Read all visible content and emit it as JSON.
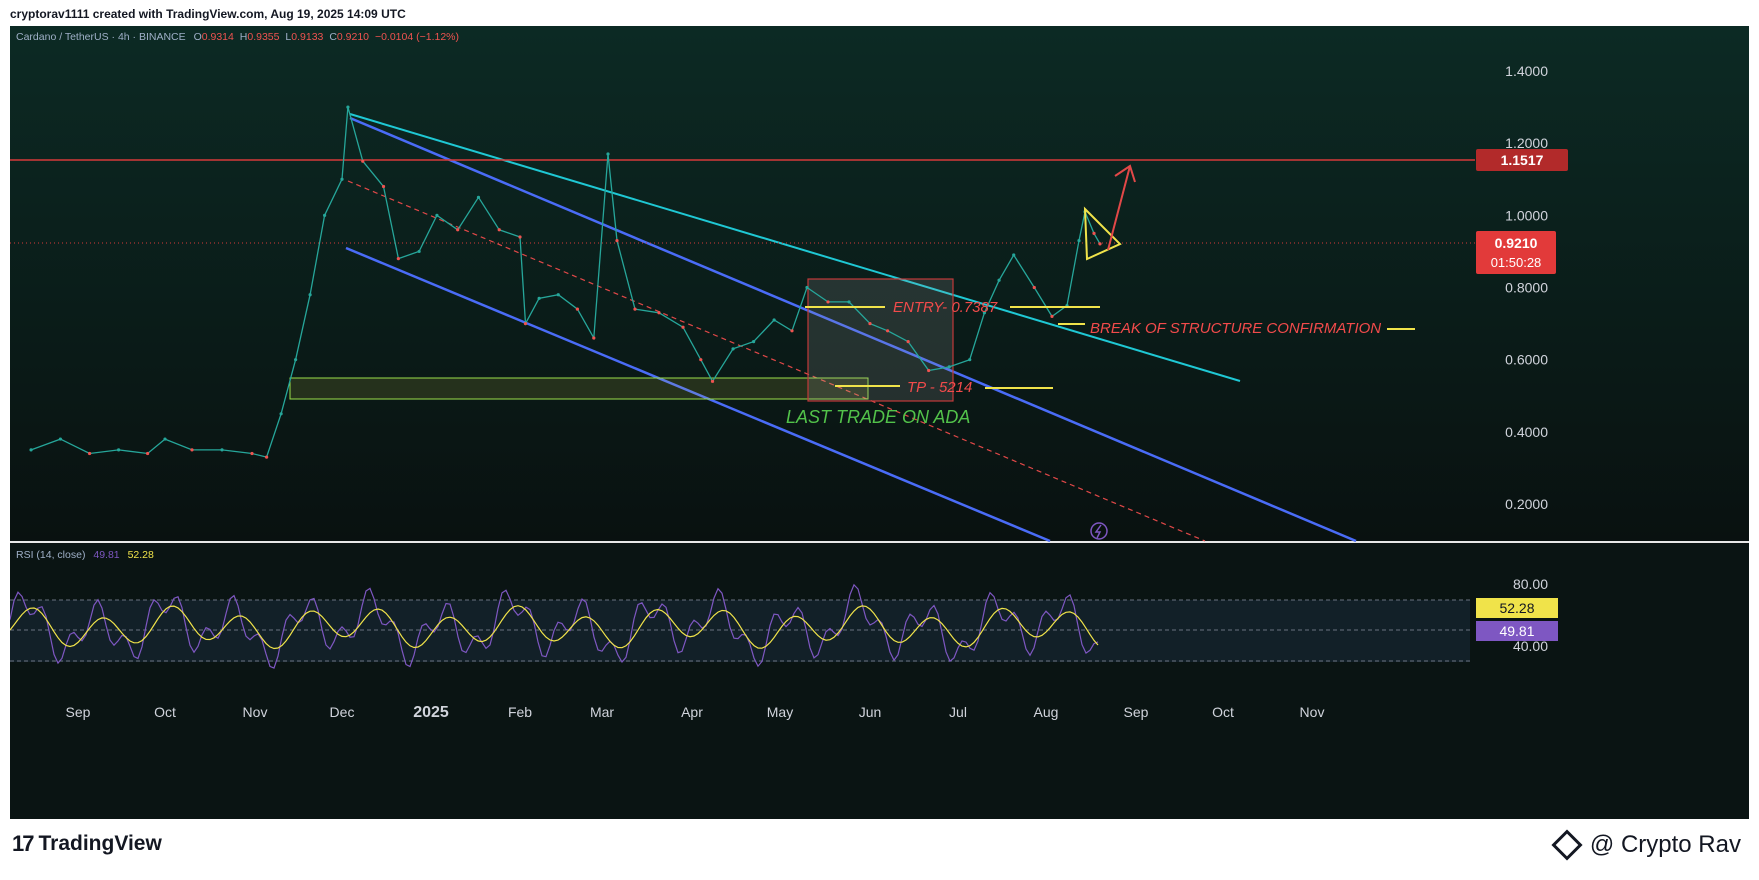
{
  "header": {
    "text": "cryptorav1111 created with TradingView.com, Aug 19, 2025 14:09 UTC"
  },
  "footer": {
    "brand": "TradingView",
    "author": "@ Crypto Rav"
  },
  "colors": {
    "background": "#0b1312",
    "up": "#26a69a",
    "down": "#ef5350",
    "channel": "#4a6cf7",
    "trendline": "#1fc8d4",
    "resistance": "#d63a3a",
    "label_yellow": "#f0e34a",
    "label_red": "#f24b4b",
    "label_green": "#52c24a",
    "rsi_line": "#7e57c2",
    "rsi_ma": "#f0e34a"
  },
  "legend": {
    "symbol": "Cardano / TetherUS · 4h · BINANCE",
    "o_label": "O",
    "o_val": "0.9314",
    "h_label": "H",
    "h_val": "0.9355",
    "l_label": "L",
    "l_val": "0.9133",
    "c_label": "C",
    "c_val": "0.9210",
    "change": "−0.0104 (−1.12%)"
  },
  "price_badges": {
    "resistance": "1.1517",
    "last_price": "0.9210",
    "countdown": "01:50:28"
  },
  "annotations": {
    "entry": "ENTRY- 0.7387",
    "tp": "TP - 5214",
    "bos": "BREAK OF STRUCTURE CONFIRMATION",
    "last_trade": "LAST TRADE ON ADA"
  },
  "rsi": {
    "label": "RSI (14, close)",
    "value": "49.81",
    "ma_value": "52.28",
    "y_ticks": [
      "80.00",
      "40.00"
    ]
  },
  "chart_data": {
    "type": "line",
    "title": "Cardano / TetherUS · 4h · BINANCE",
    "x": [
      "Sep",
      "Oct",
      "Nov",
      "Dec",
      "2025",
      "Feb",
      "Mar",
      "Apr",
      "May",
      "Jun",
      "Jul",
      "Aug",
      "Sep",
      "Oct",
      "Nov"
    ],
    "y_ticks": [
      "1.4000",
      "1.2000",
      "1.0000",
      "0.8000",
      "0.6000",
      "0.4000",
      "0.2000"
    ],
    "ylim": [
      0.1,
      1.5
    ],
    "series": [
      {
        "name": "",
        "points": [
          [
            "Aug 15",
            0.35
          ],
          [
            "Aug 25",
            0.38
          ],
          [
            "Sep 5",
            0.34
          ],
          [
            "Sep 15",
            0.35
          ],
          [
            "Sep 25",
            0.34
          ],
          [
            "Oct 1",
            0.38
          ],
          [
            "Oct 10",
            0.35
          ],
          [
            "Oct 20",
            0.35
          ],
          [
            "Oct 30",
            0.34
          ],
          [
            "Nov 5",
            0.33
          ],
          [
            "Nov 10",
            0.45
          ],
          [
            "Nov 15",
            0.6
          ],
          [
            "Nov 20",
            0.78
          ],
          [
            "Nov 25",
            1.0
          ],
          [
            "Dec 1",
            1.1
          ],
          [
            "Dec 3",
            1.3
          ],
          [
            "Dec 8",
            1.15
          ],
          [
            "Dec 15",
            1.08
          ],
          [
            "Dec 20",
            0.88
          ],
          [
            "Dec 27",
            0.9
          ],
          [
            "Jan 3",
            1.0
          ],
          [
            "Jan 10",
            0.96
          ],
          [
            "Jan 17",
            1.05
          ],
          [
            "Jan 24",
            0.96
          ],
          [
            "Jan 31",
            0.94
          ],
          [
            "Feb 3",
            0.7
          ],
          [
            "Feb 8",
            0.77
          ],
          [
            "Feb 15",
            0.78
          ],
          [
            "Feb 22",
            0.74
          ],
          [
            "Feb 28",
            0.66
          ],
          [
            "Mar 3",
            1.17
          ],
          [
            "Mar 6",
            0.93
          ],
          [
            "Mar 12",
            0.74
          ],
          [
            "Mar 20",
            0.73
          ],
          [
            "Mar 28",
            0.69
          ],
          [
            "Apr 4",
            0.6
          ],
          [
            "Apr 8",
            0.54
          ],
          [
            "Apr 15",
            0.63
          ],
          [
            "Apr 22",
            0.65
          ],
          [
            "Apr 29",
            0.71
          ],
          [
            "May 5",
            0.68
          ],
          [
            "May 10",
            0.8
          ],
          [
            "May 17",
            0.76
          ],
          [
            "May 24",
            0.76
          ],
          [
            "May 31",
            0.7
          ],
          [
            "Jun 7",
            0.68
          ],
          [
            "Jun 14",
            0.65
          ],
          [
            "Jun 21",
            0.57
          ],
          [
            "Jun 28",
            0.58
          ],
          [
            "Jul 5",
            0.6
          ],
          [
            "Jul 10",
            0.73
          ],
          [
            "Jul 15",
            0.82
          ],
          [
            "Jul 20",
            0.89
          ],
          [
            "Jul 27",
            0.8
          ],
          [
            "Aug 3",
            0.72
          ],
          [
            "Aug 8",
            0.75
          ],
          [
            "Aug 12",
            0.93
          ],
          [
            "Aug 14",
            1.01
          ],
          [
            "Aug 17",
            0.95
          ],
          [
            "Aug 19",
            0.921
          ]
        ]
      }
    ],
    "rsi_ylim": [
      0,
      100
    ],
    "grid": false,
    "legend": "top-left"
  }
}
